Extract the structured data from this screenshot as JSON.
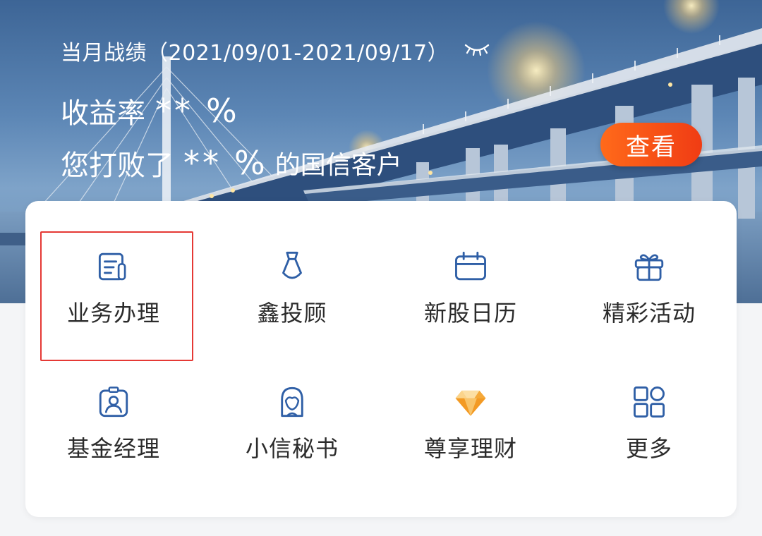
{
  "hero": {
    "title": "当月战绩（2021/09/01-2021/09/17）",
    "return_rate_label": "收益率",
    "masked_value": "**",
    "percent_sign": "%",
    "beat_prefix": "您打败了",
    "beat_suffix": "的国信客户",
    "view_button_label": "查看"
  },
  "menu": {
    "items": [
      {
        "label": "业务办理",
        "icon": "business-form-icon"
      },
      {
        "label": "鑫投顾",
        "icon": "tie-icon"
      },
      {
        "label": "新股日历",
        "icon": "calendar-icon"
      },
      {
        "label": "精彩活动",
        "icon": "gift-icon"
      },
      {
        "label": "基金经理",
        "icon": "badge-person-icon"
      },
      {
        "label": "小信秘书",
        "icon": "secretary-icon"
      },
      {
        "label": "尊享理财",
        "icon": "diamond-icon"
      },
      {
        "label": "更多",
        "icon": "grid-more-icon"
      }
    ]
  },
  "colors": {
    "icon_blue": "#2f5fa6",
    "button_orange": "#f4511e",
    "diamond_gold": "#f5a623",
    "highlight_red": "#e53935"
  }
}
